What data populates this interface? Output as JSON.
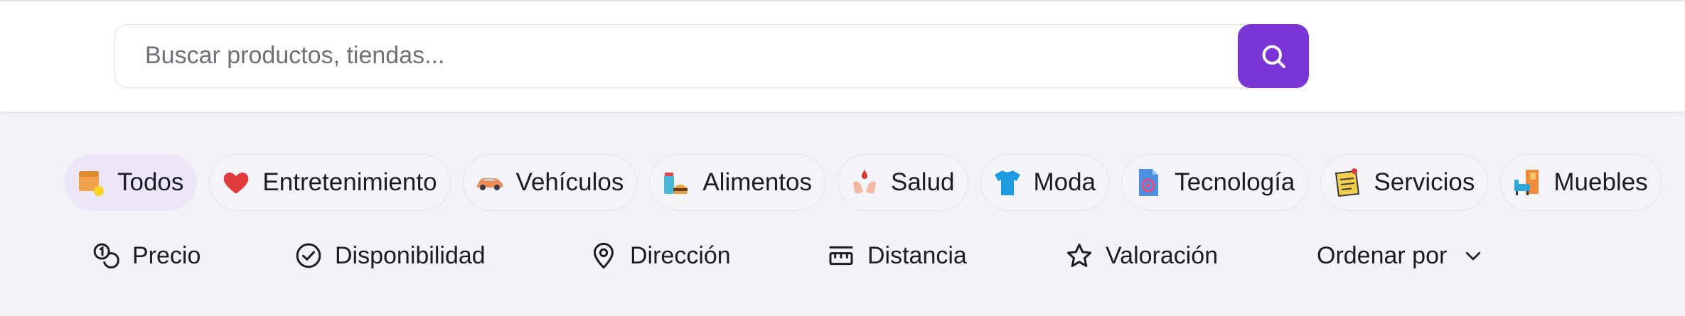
{
  "search": {
    "placeholder": "Buscar productos, tiendas...",
    "button_icon": "search-icon",
    "accent": "#7a35d4"
  },
  "categories": [
    {
      "label": "Todos",
      "icon": "all-categories-icon",
      "active": true
    },
    {
      "label": "Entretenimiento",
      "icon": "heart-icon",
      "active": false
    },
    {
      "label": "Vehículos",
      "icon": "car-icon",
      "active": false
    },
    {
      "label": "Alimentos",
      "icon": "food-icon",
      "active": false
    },
    {
      "label": "Salud",
      "icon": "health-icon",
      "active": false
    },
    {
      "label": "Moda",
      "icon": "tshirt-icon",
      "active": false
    },
    {
      "label": "Tecnología",
      "icon": "tech-icon",
      "active": false
    },
    {
      "label": "Servicios",
      "icon": "notepad-icon",
      "active": false
    },
    {
      "label": "Muebles",
      "icon": "furniture-icon",
      "active": false
    }
  ],
  "filters": [
    {
      "label": "Precio",
      "icon": "price-icon"
    },
    {
      "label": "Disponibilidad",
      "icon": "check-circle-icon"
    },
    {
      "label": "Dirección",
      "icon": "location-pin-icon"
    },
    {
      "label": "Distancia",
      "icon": "ruler-icon"
    },
    {
      "label": "Valoración",
      "icon": "star-icon"
    },
    {
      "label": "Ordenar por",
      "icon": "chevron-down-icon"
    }
  ]
}
